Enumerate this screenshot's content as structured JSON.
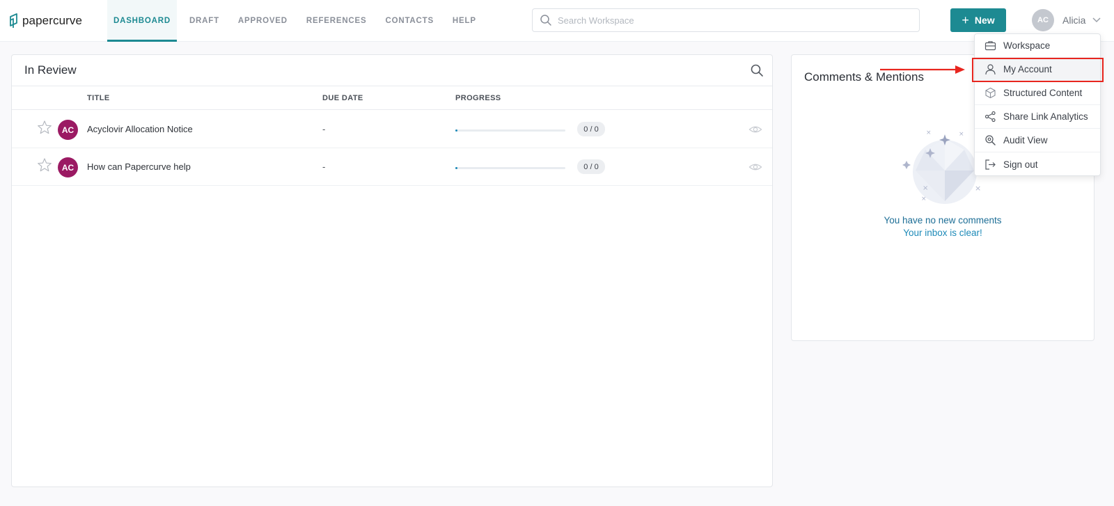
{
  "app": {
    "name": "papercurve"
  },
  "nav": {
    "items": [
      {
        "label": "DASHBOARD",
        "active": true
      },
      {
        "label": "DRAFT"
      },
      {
        "label": "APPROVED"
      },
      {
        "label": "REFERENCES"
      },
      {
        "label": "CONTACTS"
      },
      {
        "label": "HELP"
      }
    ]
  },
  "search": {
    "placeholder": "Search Workspace",
    "value": ""
  },
  "new_button": {
    "label": "New"
  },
  "user": {
    "initials": "AC",
    "name": "Alicia"
  },
  "review": {
    "title": "In Review",
    "columns": {
      "title": "TITLE",
      "due_date": "DUE DATE",
      "progress": "PROGRESS"
    },
    "rows": [
      {
        "initials": "AC",
        "title": "Acyclovir Allocation Notice",
        "due": "-",
        "progress_text": "0 / 0",
        "progress_pct": 0
      },
      {
        "initials": "AC",
        "title": "How can Papercurve help",
        "due": "-",
        "progress_text": "0 / 0",
        "progress_pct": 0
      }
    ]
  },
  "comments": {
    "title": "Comments & Mentions",
    "empty_line1": "You have no new comments",
    "empty_line2": "Your inbox is clear!"
  },
  "user_menu": {
    "items": [
      {
        "label": "Workspace",
        "icon": "briefcase-icon"
      },
      {
        "label": "My Account",
        "icon": "user-icon",
        "highlighted": true
      },
      {
        "label": "Structured Content",
        "icon": "cube-icon"
      },
      {
        "label": "Share Link Analytics",
        "icon": "share-icon"
      },
      {
        "label": "Audit View",
        "icon": "audit-search-icon"
      },
      {
        "label": "Sign out",
        "icon": "sign-out-icon"
      }
    ]
  },
  "colors": {
    "accent": "#1d8a92",
    "avatar": "#9b1a63",
    "annotation": "#e8261f"
  }
}
